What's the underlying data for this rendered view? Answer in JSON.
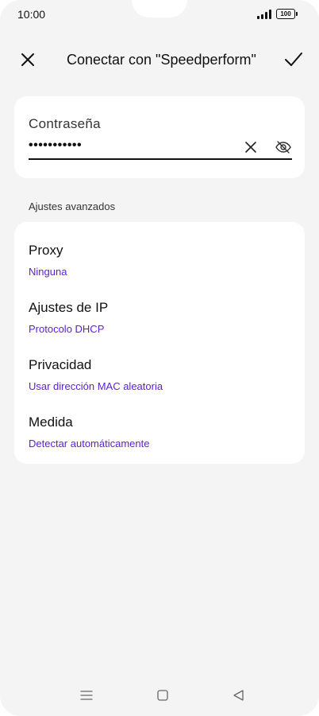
{
  "status_bar": {
    "time": "10:00",
    "battery": "100"
  },
  "header": {
    "title": "Conectar con \"Speedperform\""
  },
  "password": {
    "label": "Contraseña",
    "value": "•••••••••••"
  },
  "advanced": {
    "section_label": "Ajustes avanzados",
    "items": [
      {
        "title": "Proxy",
        "value": "Ninguna"
      },
      {
        "title": "Ajustes de IP",
        "value": "Protocolo DHCP"
      },
      {
        "title": "Privacidad",
        "value": "Usar dirección MAC aleatoria"
      },
      {
        "title": "Medida",
        "value": "Detectar automáticamente"
      }
    ]
  },
  "colors": {
    "accent": "#5b21d6",
    "background": "#f4f4f5",
    "card": "#ffffff"
  },
  "icons": {
    "close": "close-icon",
    "confirm": "check-icon",
    "clear": "clear-icon",
    "visibility": "eye-off-icon",
    "nav_menu": "menu-icon",
    "nav_home": "home-square-icon",
    "nav_back": "back-triangle-icon"
  }
}
